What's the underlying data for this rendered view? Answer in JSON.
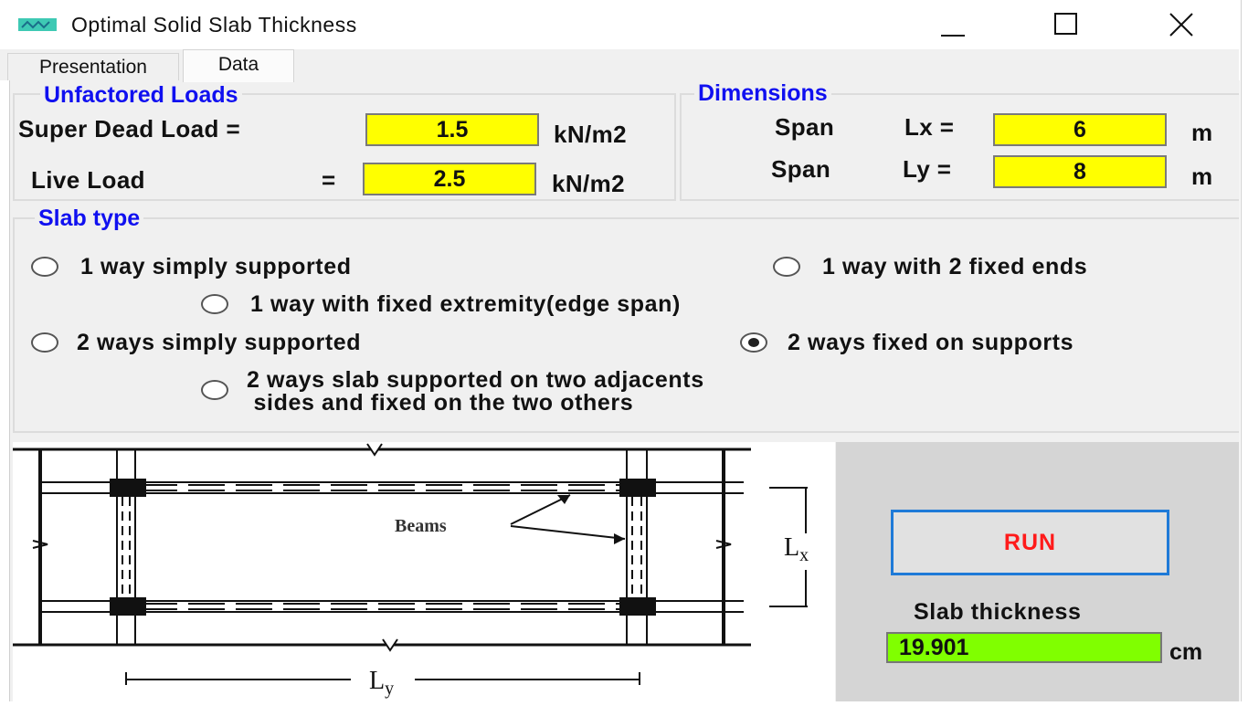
{
  "window": {
    "title": "Optimal Solid Slab Thickness",
    "icon": "app-icon",
    "minimize_icon": "minimize-icon",
    "maximize_icon": "maximize-icon",
    "close_icon": "close-icon"
  },
  "tabs": [
    {
      "label": "Presentation",
      "active": false
    },
    {
      "label": "Data",
      "active": true
    }
  ],
  "loads": {
    "legend": "Unfactored Loads",
    "dead_label": "Super Dead Load =",
    "dead_value": "1.5",
    "dead_unit": "kN/m2",
    "live_label": "Live Load",
    "live_eq": "=",
    "live_value": "2.5",
    "live_unit": "kN/m2"
  },
  "dimensions": {
    "legend": "Dimensions",
    "lx_span": "Span",
    "lx_label": "Lx =",
    "lx_value": "6",
    "lx_unit": "m",
    "ly_span": "Span",
    "ly_label": "Ly =",
    "ly_value": "8",
    "ly_unit": "m"
  },
  "slab_type": {
    "legend": "Slab type",
    "options": [
      {
        "label": "1 way simply supported",
        "checked": false
      },
      {
        "label": "1 way with 2 fixed ends",
        "checked": false
      },
      {
        "label": "1 way with fixed extremity(edge span)",
        "checked": false
      },
      {
        "label": "2 ways simply supported",
        "checked": false
      },
      {
        "label": "2 ways fixed on supports",
        "checked": true
      },
      {
        "label_line1": "2 ways slab supported on two adjacents",
        "label_line2": " sides and fixed on the two others",
        "checked": false
      }
    ]
  },
  "diagram": {
    "beams_label": "Beams",
    "lx_label": "Lx",
    "ly_label": "Ly"
  },
  "run": {
    "label": "RUN",
    "color": "#ff1a1a",
    "border_color": "#1e7ad8"
  },
  "result": {
    "label": "Slab thickness",
    "value": "19.901",
    "unit": "cm",
    "color": "#80ff00"
  },
  "colors": {
    "legend": "#1010f0",
    "input_bg": "#ffff00"
  }
}
